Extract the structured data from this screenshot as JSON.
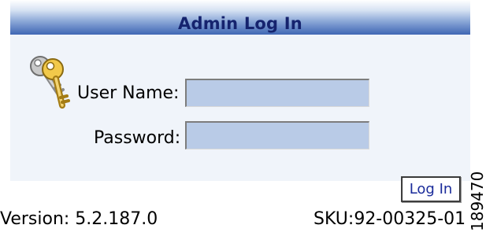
{
  "panel": {
    "title": "Admin Log In",
    "icon": "keys-icon",
    "header_color": "#3f66b4",
    "title_color": "#15236e"
  },
  "form": {
    "username_label": "User Name:",
    "username_value": "",
    "password_label": "Password:",
    "password_value": "",
    "field_color": "#b9cbe7"
  },
  "actions": {
    "login_label": "Log In"
  },
  "footer": {
    "version": "Version: 5.2.187.0",
    "sku": "SKU:92-00325-01"
  },
  "figure_id": "189470"
}
